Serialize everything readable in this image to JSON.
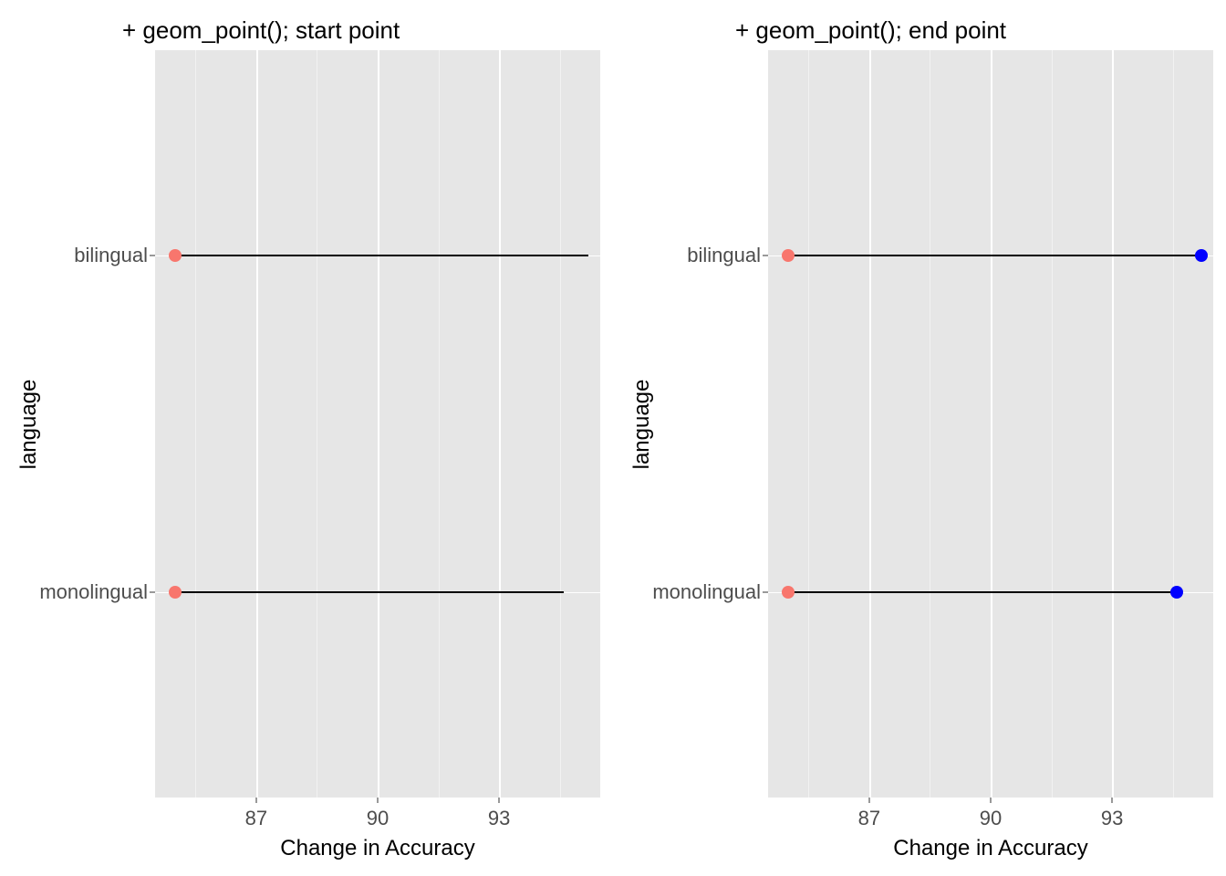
{
  "chart_data": [
    {
      "type": "dumbbell",
      "title": "+ geom_point(); start point",
      "xlabel": "Change in Accuracy",
      "ylabel": "language",
      "x_ticks": [
        87,
        90,
        93
      ],
      "x_range": [
        84.5,
        95.5
      ],
      "categories": [
        "bilingual",
        "monolingual"
      ],
      "segments": [
        {
          "category": "bilingual",
          "x_start": 85.0,
          "x_end": 95.2
        },
        {
          "category": "monolingual",
          "x_start": 85.0,
          "x_end": 94.6
        }
      ],
      "points": [
        {
          "category": "bilingual",
          "x": 85.0,
          "color": "red"
        },
        {
          "category": "monolingual",
          "x": 85.0,
          "color": "red"
        }
      ],
      "colors": {
        "red": "#F8766D",
        "blue": "#0000FF"
      }
    },
    {
      "type": "dumbbell",
      "title": "+ geom_point(); end point",
      "xlabel": "Change in Accuracy",
      "ylabel": "language",
      "x_ticks": [
        87,
        90,
        93
      ],
      "x_range": [
        84.5,
        95.5
      ],
      "categories": [
        "bilingual",
        "monolingual"
      ],
      "segments": [
        {
          "category": "bilingual",
          "x_start": 85.0,
          "x_end": 95.2
        },
        {
          "category": "monolingual",
          "x_start": 85.0,
          "x_end": 94.6
        }
      ],
      "points": [
        {
          "category": "bilingual",
          "x": 85.0,
          "color": "red"
        },
        {
          "category": "bilingual",
          "x": 95.2,
          "color": "blue"
        },
        {
          "category": "monolingual",
          "x": 85.0,
          "color": "red"
        },
        {
          "category": "monolingual",
          "x": 94.6,
          "color": "blue"
        }
      ],
      "colors": {
        "red": "#F8766D",
        "blue": "#0000FF"
      }
    }
  ]
}
